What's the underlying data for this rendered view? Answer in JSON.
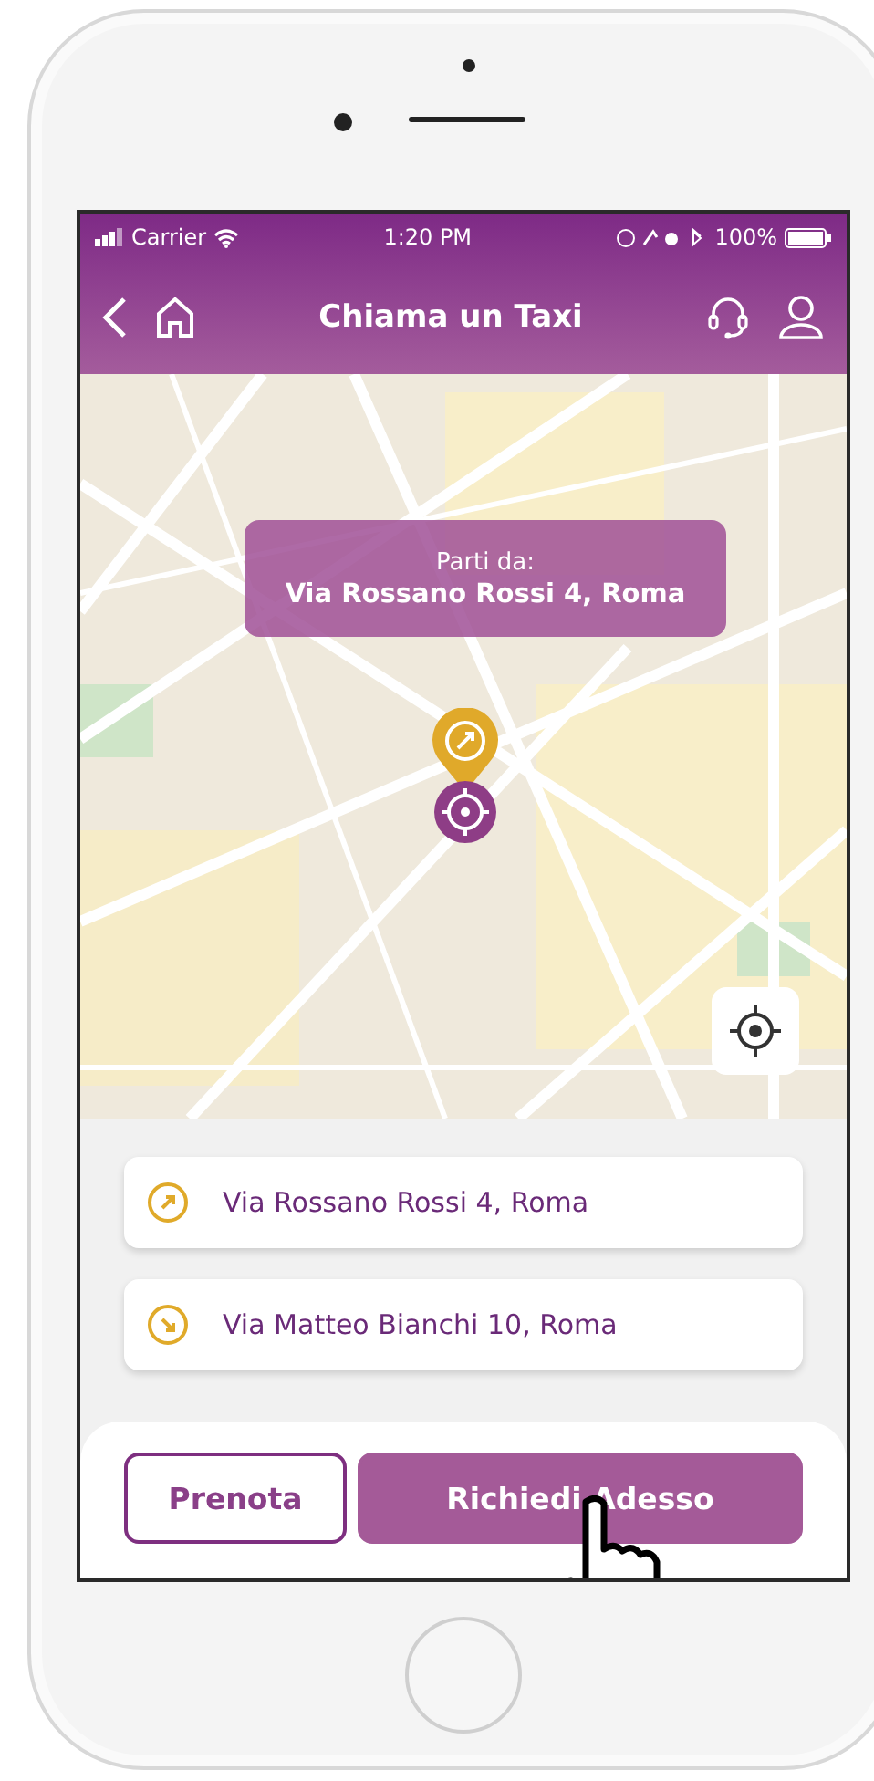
{
  "status_bar": {
    "carrier": "Carrier",
    "time": "1:20 PM",
    "battery": "100%"
  },
  "nav": {
    "title": "Chiama un Taxi"
  },
  "map_callout": {
    "label": "Parti da:",
    "address": "Via Rossano Rossi 4, Roma"
  },
  "route": [
    {
      "kind": "origin",
      "address": "Via Rossano Rossi 4, Roma"
    },
    {
      "kind": "destination",
      "address": "Via Matteo Bianchi 10, Roma"
    }
  ],
  "actions": [
    {
      "kind": "outline",
      "label": "Prenota"
    },
    {
      "kind": "filled",
      "label": "Richiedi Adesso"
    }
  ]
}
